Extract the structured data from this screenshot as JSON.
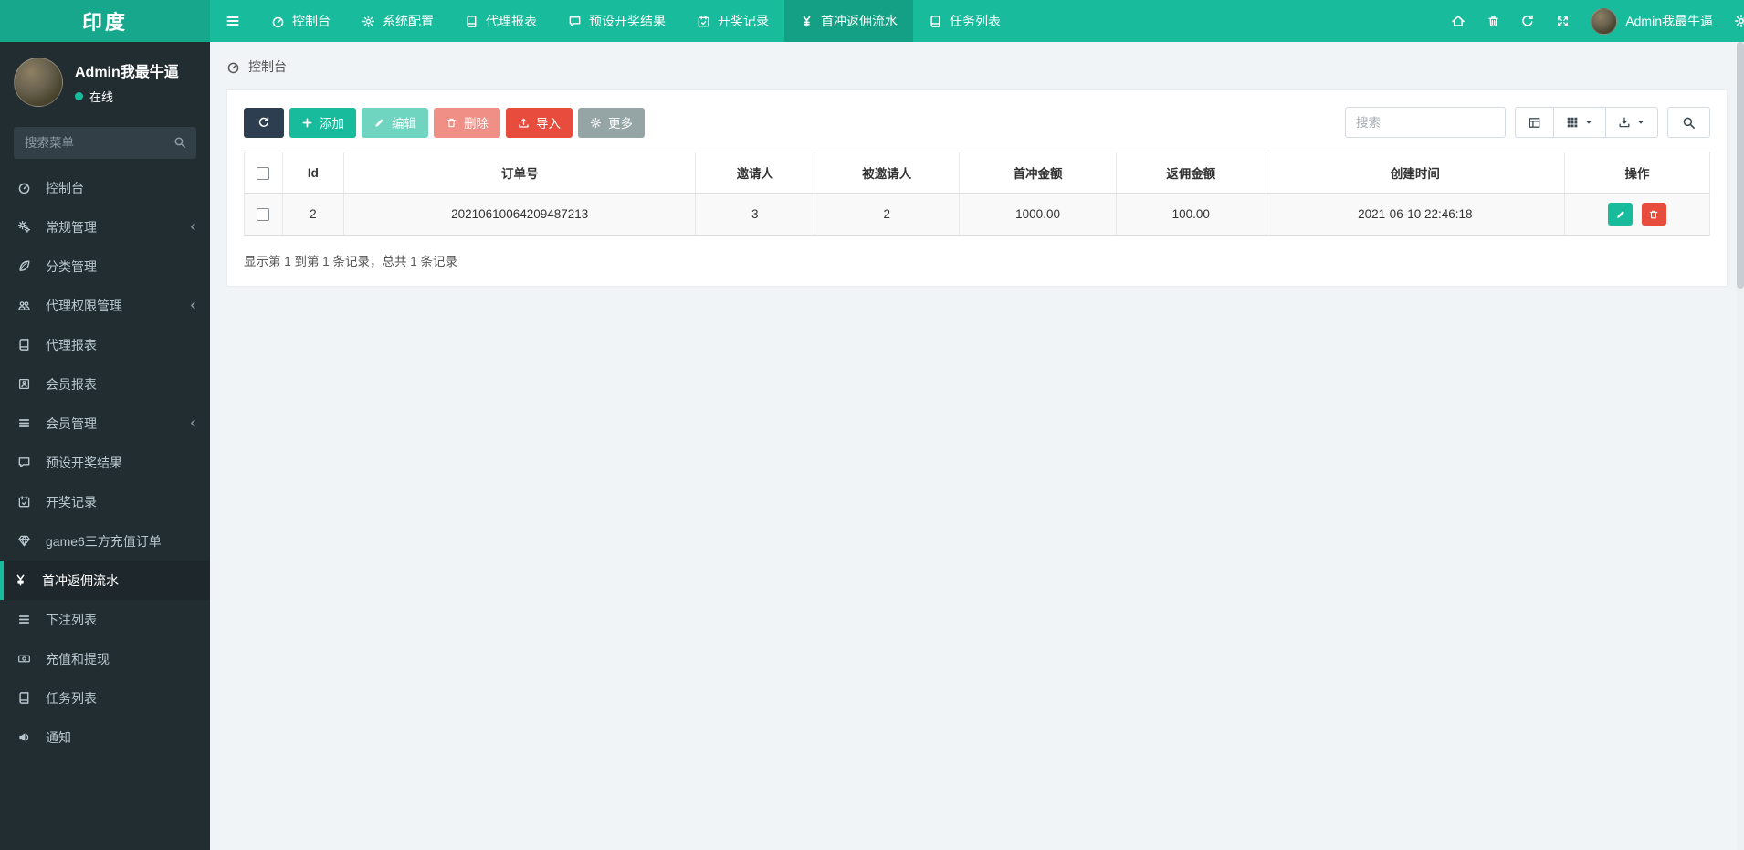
{
  "topbar": {
    "logo": "印度",
    "tabs": [
      {
        "label": "控制台",
        "icon": "gauge-icon",
        "active": false
      },
      {
        "label": "系统配置",
        "icon": "gear-icon",
        "active": false
      },
      {
        "label": "代理报表",
        "icon": "book-icon",
        "active": false
      },
      {
        "label": "预设开奖结果",
        "icon": "comment-icon",
        "active": false
      },
      {
        "label": "开奖记录",
        "icon": "calendar-check-icon",
        "active": false
      },
      {
        "label": "首冲返佣流水",
        "icon": "yen-icon",
        "active": true
      },
      {
        "label": "任务列表",
        "icon": "book-icon",
        "active": false
      }
    ],
    "username": "Admin我最牛逼",
    "right_icons": [
      "home-icon",
      "trash-icon",
      "clear-cache-icon",
      "fullscreen-icon",
      "gear-icon"
    ]
  },
  "sidebar": {
    "username": "Admin我最牛逼",
    "status": "在线",
    "search_placeholder": "搜索菜单",
    "items": [
      {
        "label": "控制台",
        "icon": "gauge-icon",
        "active": false,
        "expandable": false
      },
      {
        "label": "常规管理",
        "icon": "gears-icon",
        "active": false,
        "expandable": true
      },
      {
        "label": "分类管理",
        "icon": "leaf-icon",
        "active": false,
        "expandable": false
      },
      {
        "label": "代理权限管理",
        "icon": "users-icon",
        "active": false,
        "expandable": true
      },
      {
        "label": "代理报表",
        "icon": "book-icon",
        "active": false,
        "expandable": false
      },
      {
        "label": "会员报表",
        "icon": "id-card-icon",
        "active": false,
        "expandable": false
      },
      {
        "label": "会员管理",
        "icon": "list-icon",
        "active": false,
        "expandable": true
      },
      {
        "label": "预设开奖结果",
        "icon": "comment-icon",
        "active": false,
        "expandable": false
      },
      {
        "label": "开奖记录",
        "icon": "calendar-check-icon",
        "active": false,
        "expandable": false
      },
      {
        "label": "game6三方充值订单",
        "icon": "gem-icon",
        "active": false,
        "expandable": false
      },
      {
        "label": "首冲返佣流水",
        "icon": "yen-icon",
        "active": true,
        "expandable": false
      },
      {
        "label": "下注列表",
        "icon": "list-icon",
        "active": false,
        "expandable": false
      },
      {
        "label": "充值和提现",
        "icon": "money-icon",
        "active": false,
        "expandable": false
      },
      {
        "label": "任务列表",
        "icon": "book-icon",
        "active": false,
        "expandable": false
      },
      {
        "label": "通知",
        "icon": "bullhorn-icon",
        "active": false,
        "expandable": false
      }
    ]
  },
  "breadcrumb": {
    "label": "控制台",
    "icon": "gauge-icon"
  },
  "toolbar": {
    "add_label": "添加",
    "edit_label": "编辑",
    "delete_label": "删除",
    "import_label": "导入",
    "more_label": "更多",
    "search_placeholder": "搜索"
  },
  "table": {
    "columns": [
      "Id",
      "订单号",
      "邀请人",
      "被邀请人",
      "首冲金额",
      "返佣金额",
      "创建时间",
      "操作"
    ],
    "rows": [
      {
        "id": "2",
        "order_no": "20210610064209487213",
        "inviter": "3",
        "invitee": "2",
        "first_charge_amount": "1000.00",
        "commission_amount": "100.00",
        "created_at": "2021-06-10 22:46:18"
      }
    ]
  },
  "pagination": {
    "summary": "显示第 1 到第 1 条记录，总共 1 条记录"
  },
  "colors": {
    "accent": "#18bc9c",
    "dark": "#2c3e50",
    "danger": "#e74c3c",
    "muted": "#95a5a6",
    "sidebar_bg": "#222d32"
  }
}
